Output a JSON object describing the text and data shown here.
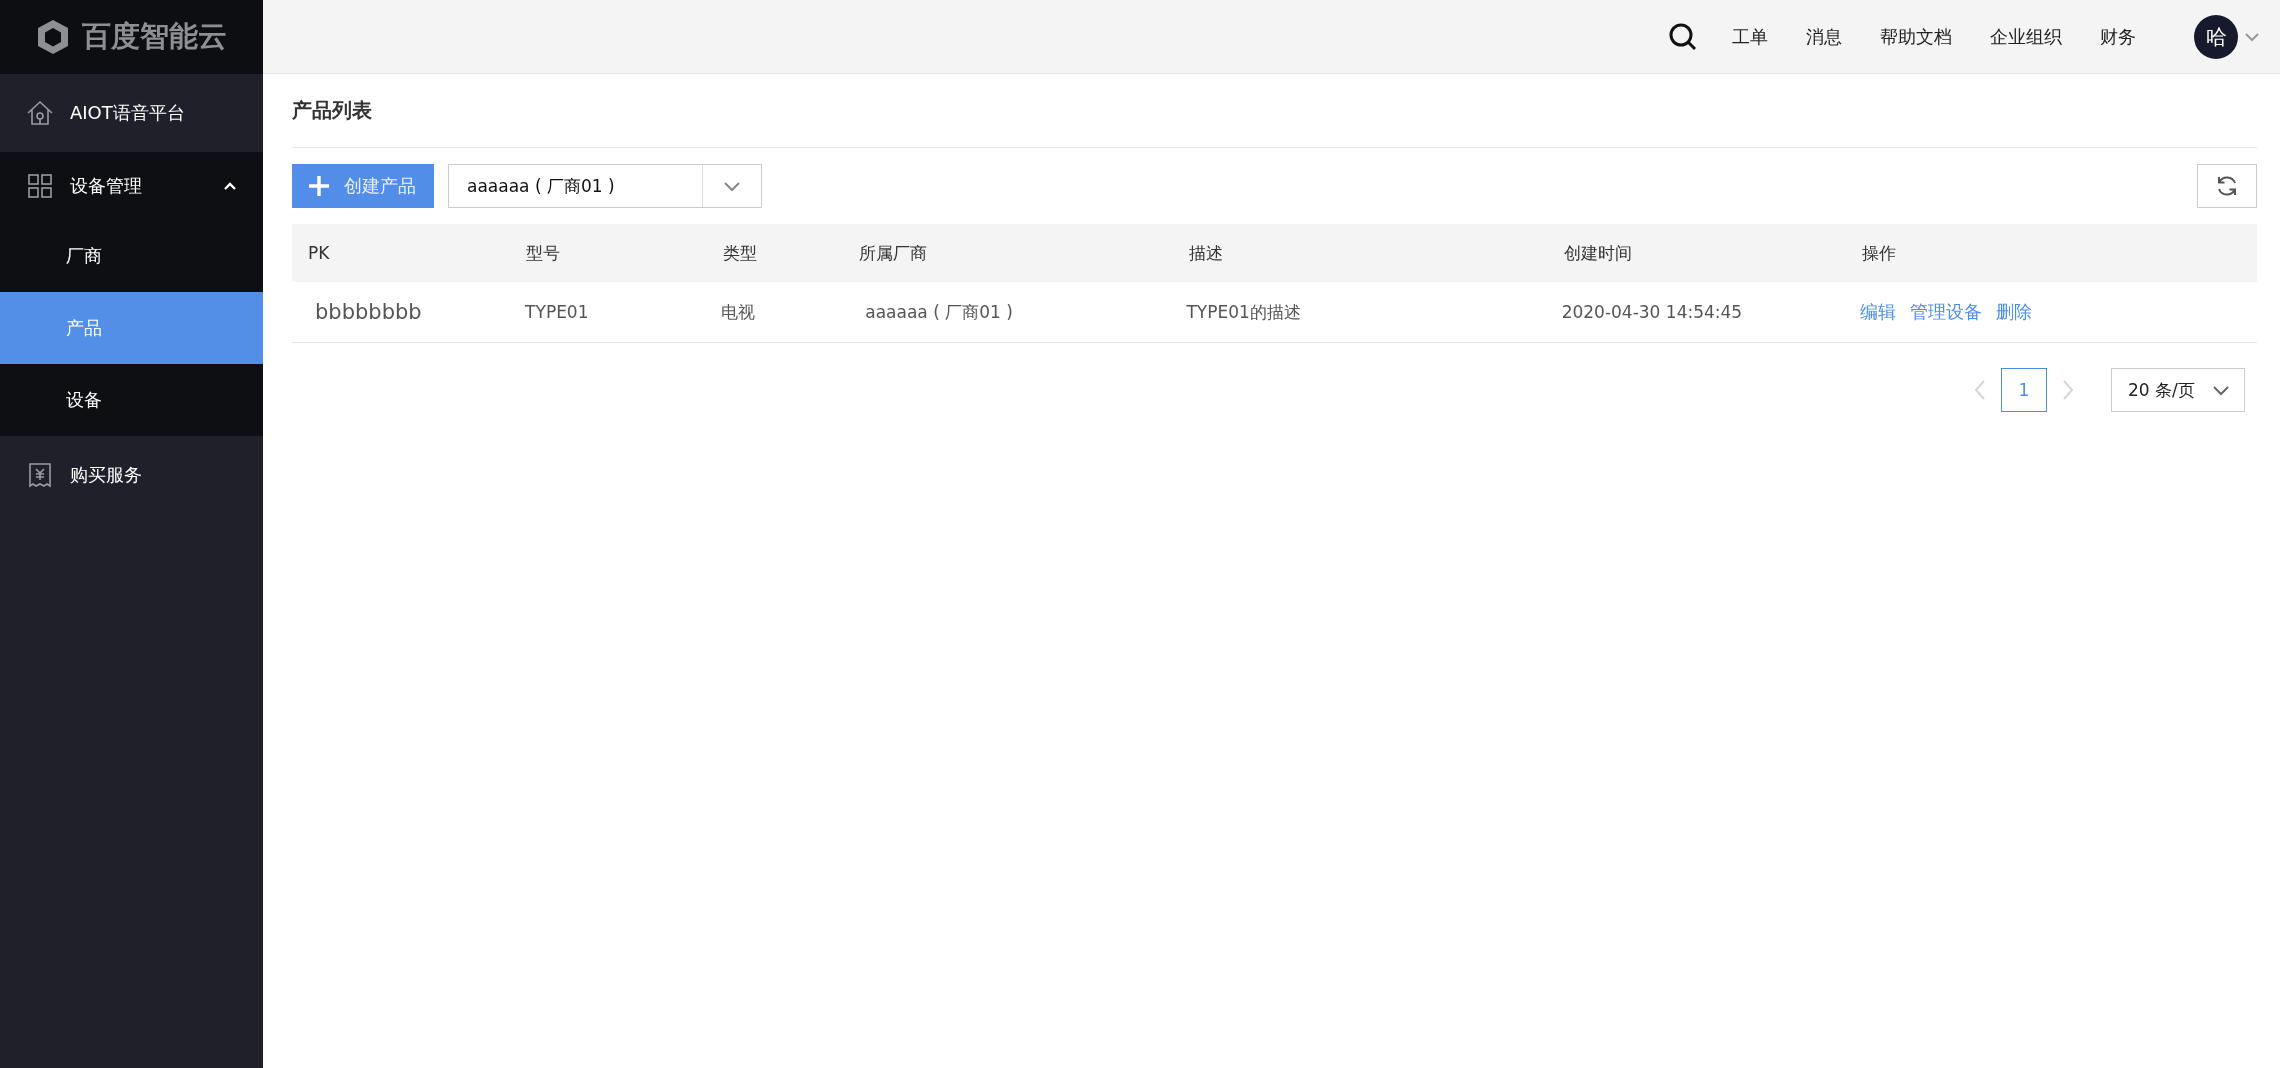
{
  "logo": {
    "text": "百度智能云"
  },
  "sidebar": {
    "items": [
      {
        "label": "AIOT语音平台",
        "selected": false
      },
      {
        "label": "设备管理",
        "selected": false,
        "expanded": true,
        "children": [
          {
            "label": "厂商",
            "selected": false
          },
          {
            "label": "产品",
            "selected": true
          },
          {
            "label": "设备",
            "selected": false
          }
        ]
      },
      {
        "label": "购买服务",
        "selected": false
      }
    ]
  },
  "top_nav": {
    "links": [
      "工单",
      "消息",
      "帮助文档",
      "企业组织",
      "财务"
    ],
    "avatar": "哈"
  },
  "page": {
    "title": "产品列表"
  },
  "toolbar": {
    "create_button": "创建产品",
    "vendor_select": "aaaaaa ( 厂商01 )"
  },
  "table": {
    "columns": [
      "PK",
      "型号",
      "类型",
      "所属厂商",
      "描述",
      "创建时间",
      "操作"
    ],
    "rows": [
      {
        "cells": [
          "bbbbbbbb",
          "TYPE01",
          "电视",
          "aaaaaa ( 厂商01 )",
          "TYPE01的描述",
          "2020-04-30 14:54:45"
        ],
        "actions": [
          "编辑",
          "管理设备",
          "删除"
        ]
      }
    ]
  },
  "pagination": {
    "prev_disabled": true,
    "next_disabled": true,
    "pages": [
      {
        "label": "1",
        "selected": true
      }
    ],
    "page_size": "20 条/页"
  }
}
